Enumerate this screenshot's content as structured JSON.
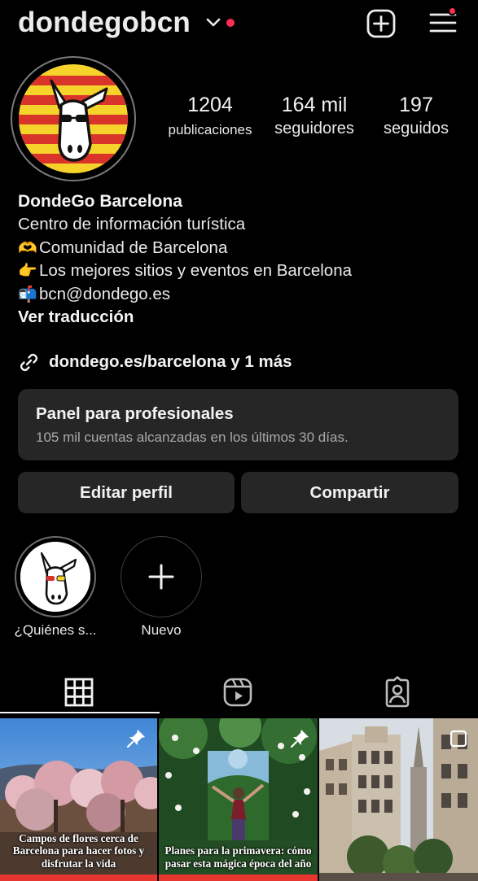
{
  "header": {
    "username": "dondegobcn",
    "add_icon": "plus-square-icon",
    "menu_icon": "hamburger-menu-icon",
    "notification_color": "#ff2d55"
  },
  "profile": {
    "stats": [
      {
        "value": "1204",
        "label": "publicaciones"
      },
      {
        "value": "164 mil",
        "label": "seguidores"
      },
      {
        "value": "197",
        "label": "seguidos"
      }
    ],
    "name": "DondeGo Barcelona",
    "bio_lines": [
      {
        "emoji": "",
        "text": "Centro de información turística"
      },
      {
        "emoji": "🫶",
        "text": "Comunidad de Barcelona"
      },
      {
        "emoji": "👉",
        "text": "Los mejores sitios y eventos en Barcelona"
      },
      {
        "emoji": "📬",
        "text": "bcn@dondego.es"
      }
    ],
    "translate_label": "Ver traducción",
    "link_text": "dondego.es/barcelona y 1 más"
  },
  "dashboard": {
    "title": "Panel para profesionales",
    "subtitle": "105 mil cuentas alcanzadas en los últimos 30 días."
  },
  "actions": {
    "edit_label": "Editar perfil",
    "share_label": "Compartir"
  },
  "highlights": [
    {
      "label": "¿Quiénes s..."
    },
    {
      "label": "Nuevo"
    }
  ],
  "tabs": [
    {
      "icon": "grid-icon",
      "active": true
    },
    {
      "icon": "reels-icon",
      "active": false
    },
    {
      "icon": "tagged-icon",
      "active": false
    }
  ],
  "posts": [
    {
      "caption": "Campos de flores cerca de Barcelona para hacer fotos y disfrutar la vida",
      "pinned": true
    },
    {
      "caption": "Planes para la primavera: cómo pasar esta mágica época del año",
      "pinned": true
    },
    {
      "caption": "",
      "pinned": false
    }
  ],
  "colors": {
    "background": "#000000",
    "card": "#262626",
    "accent_red": "#e6362f",
    "catalan_yellow": "#f6d32b",
    "catalan_red": "#d8342a"
  }
}
